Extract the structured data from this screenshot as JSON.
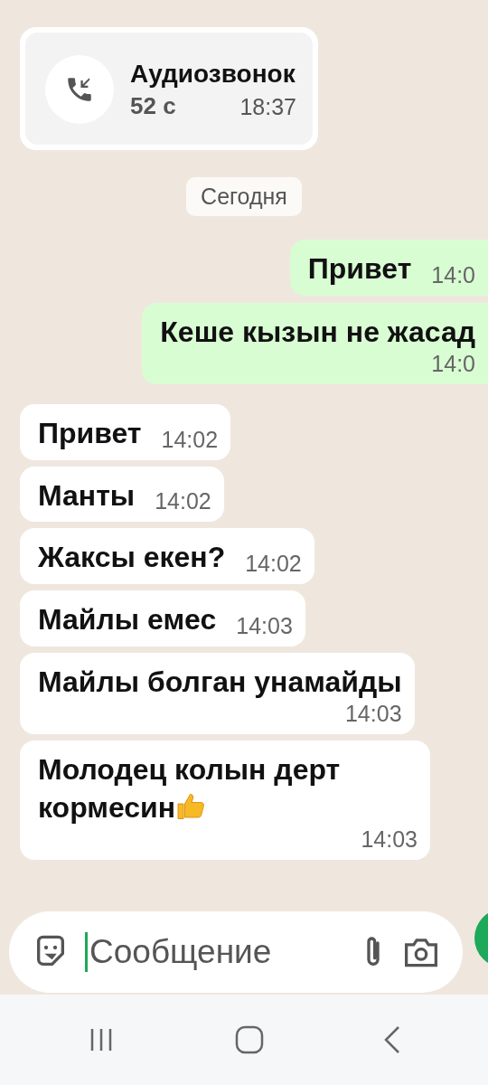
{
  "call": {
    "title": "Аудиозвонок",
    "duration": "52 с",
    "time": "18:37"
  },
  "date_chip": "Сегодня",
  "messages": [
    {
      "kind": "outgoing",
      "text": "Привет",
      "time": "14:0",
      "emoji": false
    },
    {
      "kind": "outgoing",
      "text": "Кеше кызын не жасад",
      "time": "14:0",
      "emoji": false
    },
    {
      "kind": "incoming",
      "text": "Привет",
      "time": "14:02",
      "emoji": false
    },
    {
      "kind": "incoming",
      "text": "Манты",
      "time": "14:02",
      "emoji": false
    },
    {
      "kind": "incoming",
      "text": "Жаксы екен?",
      "time": "14:02",
      "emoji": false
    },
    {
      "kind": "incoming",
      "text": "Майлы емес",
      "time": "14:03",
      "emoji": false
    },
    {
      "kind": "incoming",
      "text": "Майлы болган унамайды",
      "time": "14:03",
      "emoji": false
    },
    {
      "kind": "incoming",
      "text": "Молодец колын дерт кормесин",
      "time": "14:03",
      "emoji": true
    }
  ],
  "composer": {
    "placeholder": "Сообщение"
  }
}
